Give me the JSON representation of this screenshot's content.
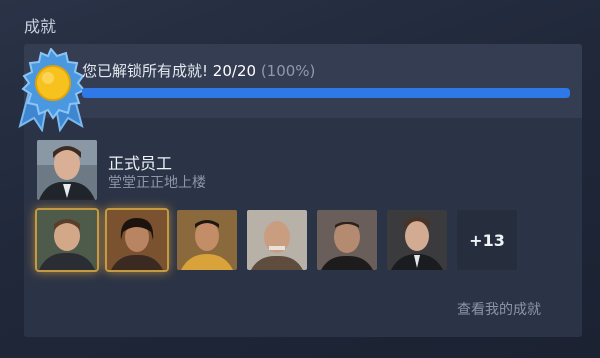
{
  "section": {
    "title": "成就"
  },
  "summary": {
    "text": "您已解锁所有成就!",
    "count": "20/20",
    "percent_text": "(100%)",
    "progress": 1.0
  },
  "featured": {
    "name": "正式员工",
    "description": "堂堂正正地上楼"
  },
  "more_count": "+13",
  "view_link": "查看我的成就",
  "colors": {
    "progress_fill": "#2f78e8",
    "badge_blue": "#4a98e0",
    "badge_sun": "#f7c21e",
    "glow": "#c49a42"
  }
}
